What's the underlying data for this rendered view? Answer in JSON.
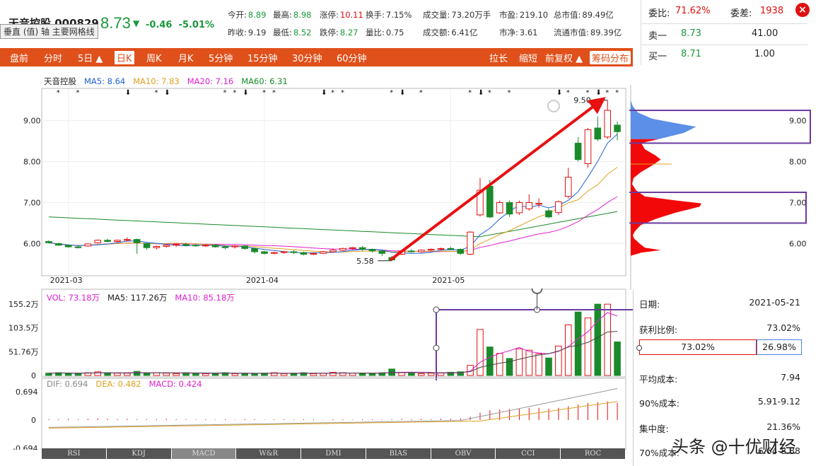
{
  "stock": {
    "name": "天音控股",
    "code": "000829",
    "price": "8.73",
    "arrow": "▼",
    "change": "-0.46",
    "change_pct": "-5.01%",
    "tooltip": "垂直 (值) 轴 主要网格线"
  },
  "quotes": {
    "row1": [
      {
        "label": "今开:",
        "value": "8.89",
        "color": "green"
      },
      {
        "label": "最高:",
        "value": "8.98",
        "color": "green"
      },
      {
        "label": "涨停:",
        "value": "10.11",
        "color": "red"
      },
      {
        "label": "换手:",
        "value": "7.15%",
        "color": "black"
      },
      {
        "label": "成交量:",
        "value": "73.20万手",
        "color": "black"
      },
      {
        "label": "市盈:",
        "value": "219.10",
        "color": "black"
      },
      {
        "label": "总市值:",
        "value": "89.49亿",
        "color": "black"
      }
    ],
    "row2": [
      {
        "label": "昨收:",
        "value": "9.19",
        "color": "black"
      },
      {
        "label": "最低:",
        "value": "8.52",
        "color": "green"
      },
      {
        "label": "跌停:",
        "value": "8.27",
        "color": "green"
      },
      {
        "label": "量比:",
        "value": "0.75",
        "color": "black"
      },
      {
        "label": "成交额:",
        "value": "6.41亿",
        "color": "black"
      },
      {
        "label": "市净:",
        "value": "3.61",
        "color": "black"
      },
      {
        "label": "流通市值:",
        "value": "89.39亿",
        "color": "black"
      }
    ]
  },
  "book": {
    "wei_bi_label": "委比:",
    "wei_bi_value": "71.62%",
    "wei_cha_label": "委差:",
    "wei_cha_value": "1938",
    "sell1_label": "卖一",
    "sell1_price": "8.73",
    "sell1_vol": "41.00",
    "buy1_label": "买一",
    "buy1_price": "8.71",
    "buy1_vol": "1.00",
    "close": "×"
  },
  "toolbar": {
    "left": [
      "盘前",
      "分时",
      "5日 ▲",
      "日K",
      "周K",
      "月K",
      "5分钟",
      "15分钟",
      "30分钟",
      "60分钟"
    ],
    "right": [
      "拉长",
      "缩短",
      "前复权 ▲",
      "筹码分布"
    ],
    "active": "日K"
  },
  "main_legend": {
    "name": "天音控股",
    "ma5": "MA5: 8.64",
    "ma10": "MA10: 7.83",
    "ma20": "MA20: 7.16",
    "ma60": "MA60: 6.31"
  },
  "vol_legend": {
    "vol": "VOL: 73.18万",
    "ma5": "MA5: 117.26万",
    "ma10": "MA10: 85.18万"
  },
  "macd_legend": {
    "dif": "DIF: 0.694",
    "dea": "DEA: 0.482",
    "macd": "MACD: 0.424"
  },
  "tabs": [
    "RSI",
    "KDJ",
    "MACD",
    "W&R",
    "DMI",
    "BIAS",
    "OBV",
    "CCI",
    "ROC"
  ],
  "info": [
    {
      "label": "日期:",
      "value": "2021-05-21"
    },
    {
      "label": "获利比例:",
      "value": "73.02%"
    },
    {
      "label": "平均成本:",
      "value": "7.94"
    },
    {
      "label": "90%成本:",
      "value": "5.91-9.12"
    },
    {
      "label": "集中度:",
      "value": "21.36%"
    },
    {
      "label": "70%成本:",
      "value": "6.64-8.88"
    }
  ],
  "profit_bar": {
    "profit": "73.02%",
    "loss": "26.98%"
  },
  "watermark": "头条 @十优财经",
  "chart_data": [
    {
      "type": "candlestick",
      "title": "",
      "ylim": [
        5.3,
        9.7
      ],
      "yticks": [
        "9.00",
        "8.00",
        "7.00",
        "6.00"
      ],
      "xticks": [
        "2021-03",
        "2021-04",
        "2021-05"
      ],
      "annotations": {
        "high": "9.50",
        "low": "5.58"
      },
      "candles": [
        [
          6.05,
          6.08,
          6.02,
          6.0
        ],
        [
          6.0,
          6.02,
          5.96,
          5.95
        ],
        [
          5.96,
          5.98,
          5.92,
          5.9
        ],
        [
          5.92,
          5.94,
          5.9,
          5.88
        ],
        [
          5.94,
          6.0,
          5.99,
          5.92
        ],
        [
          6.02,
          6.1,
          6.08,
          6.0
        ],
        [
          6.08,
          6.12,
          6.05,
          6.03
        ],
        [
          6.05,
          6.1,
          6.08,
          6.02
        ],
        [
          6.08,
          6.15,
          6.1,
          6.05
        ],
        [
          6.1,
          6.12,
          6.02,
          5.75
        ],
        [
          6.0,
          6.02,
          5.9,
          5.85
        ],
        [
          5.9,
          5.95,
          5.93,
          5.86
        ],
        [
          5.93,
          5.98,
          5.96,
          5.9
        ],
        [
          5.96,
          6.0,
          5.98,
          5.92
        ],
        [
          5.98,
          6.02,
          5.96,
          5.93
        ],
        [
          5.96,
          6.0,
          5.95,
          5.92
        ],
        [
          5.95,
          5.98,
          5.96,
          5.92
        ],
        [
          5.96,
          5.98,
          5.92,
          5.9
        ],
        [
          5.92,
          5.95,
          5.9,
          5.86
        ],
        [
          5.92,
          5.96,
          5.94,
          5.88
        ],
        [
          5.94,
          5.96,
          5.88,
          5.85
        ],
        [
          5.88,
          5.9,
          5.8,
          5.76
        ],
        [
          5.8,
          5.82,
          5.76,
          5.73
        ],
        [
          5.76,
          5.8,
          5.78,
          5.74
        ],
        [
          5.78,
          5.82,
          5.8,
          5.75
        ],
        [
          5.8,
          5.84,
          5.78,
          5.74
        ],
        [
          5.78,
          5.8,
          5.74,
          5.71
        ],
        [
          5.74,
          5.78,
          5.76,
          5.72
        ],
        [
          5.76,
          5.82,
          5.8,
          5.74
        ],
        [
          5.8,
          5.88,
          5.84,
          5.78
        ],
        [
          5.84,
          5.9,
          5.88,
          5.82
        ],
        [
          5.88,
          5.92,
          5.9,
          5.85
        ],
        [
          5.9,
          5.94,
          5.86,
          5.82
        ],
        [
          5.86,
          5.88,
          5.82,
          5.78
        ],
        [
          5.82,
          5.84,
          5.76,
          5.7
        ],
        [
          5.66,
          5.7,
          5.6,
          5.58
        ],
        [
          5.74,
          5.84,
          5.82,
          5.72
        ],
        [
          5.82,
          5.86,
          5.8,
          5.78
        ],
        [
          5.8,
          5.86,
          5.84,
          5.78
        ],
        [
          5.84,
          5.88,
          5.86,
          5.82
        ],
        [
          5.86,
          5.9,
          5.88,
          5.83
        ],
        [
          5.88,
          5.92,
          5.86,
          5.84
        ],
        [
          5.86,
          5.88,
          5.76,
          5.72
        ],
        [
          5.74,
          6.3,
          6.28,
          5.72
        ],
        [
          6.7,
          7.6,
          7.3,
          6.66
        ],
        [
          7.4,
          7.55,
          6.65,
          6.62
        ],
        [
          6.75,
          7.05,
          7.0,
          6.72
        ],
        [
          7.0,
          7.05,
          6.72,
          6.65
        ],
        [
          6.75,
          7.05,
          7.0,
          6.7
        ],
        [
          6.85,
          7.2,
          7.0,
          6.8
        ],
        [
          6.96,
          7.1,
          6.98,
          6.88
        ],
        [
          6.8,
          6.85,
          6.65,
          6.62
        ],
        [
          6.76,
          7.05,
          7.02,
          6.7
        ],
        [
          7.15,
          7.85,
          7.62,
          7.1
        ],
        [
          8.45,
          8.6,
          8.05,
          8.0
        ],
        [
          7.95,
          8.82,
          8.78,
          7.85
        ],
        [
          8.82,
          9.1,
          8.55,
          8.5
        ],
        [
          8.6,
          9.5,
          9.25,
          8.55
        ],
        [
          8.89,
          8.98,
          8.73,
          8.52
        ]
      ]
    },
    {
      "type": "bar",
      "title": "",
      "ylabel": "",
      "yticks": [
        "155.2万",
        "103.5万",
        "51.76万",
        "0"
      ],
      "ylim": [
        0,
        155.2
      ],
      "values": [
        5,
        6,
        5,
        4,
        6,
        8,
        6,
        5,
        5,
        9,
        5,
        6,
        5,
        4,
        6,
        5,
        4,
        5,
        6,
        4,
        5,
        4,
        5,
        6,
        4,
        5,
        6,
        4,
        5,
        7,
        6,
        5,
        4,
        5,
        6,
        14,
        6,
        5,
        4,
        5,
        6,
        7,
        8,
        22,
        100,
        62,
        48,
        37,
        58,
        55,
        47,
        38,
        64,
        110,
        138,
        125,
        155,
        155,
        73
      ],
      "up": [
        0,
        0,
        0,
        0,
        1,
        1,
        0,
        1,
        1,
        0,
        0,
        1,
        1,
        1,
        0,
        0,
        1,
        0,
        0,
        1,
        0,
        0,
        0,
        1,
        1,
        0,
        0,
        1,
        1,
        1,
        1,
        1,
        0,
        0,
        0,
        0,
        1,
        0,
        1,
        1,
        1,
        0,
        0,
        1,
        1,
        0,
        1,
        0,
        1,
        1,
        1,
        0,
        1,
        1,
        0,
        1,
        0,
        1,
        0
      ]
    },
    {
      "type": "bar",
      "title": "",
      "ylabel": "",
      "yticks": [
        "0.694",
        "0",
        "-0.694"
      ],
      "ylim": [
        -0.694,
        0.694
      ],
      "values": [
        0.02,
        0.02,
        0.03,
        0.02,
        0.03,
        0.04,
        0.03,
        0.02,
        0.03,
        0.02,
        0.02,
        0.02,
        0.03,
        0.02,
        0.02,
        0.01,
        0.02,
        0.01,
        0.02,
        0.01,
        0.02,
        0.02,
        0.01,
        0.02,
        0.02,
        0.01,
        0.02,
        0.02,
        0.01,
        0.02,
        0.02,
        0.01,
        0.02,
        0.02,
        0.01,
        0.02,
        0.03,
        0.02,
        0.03,
        0.02,
        0.03,
        0.03,
        0.04,
        0.08,
        0.18,
        0.24,
        0.26,
        0.27,
        0.28,
        0.3,
        0.3,
        0.28,
        0.3,
        0.34,
        0.38,
        0.42,
        0.44,
        0.46,
        0.42
      ]
    }
  ]
}
